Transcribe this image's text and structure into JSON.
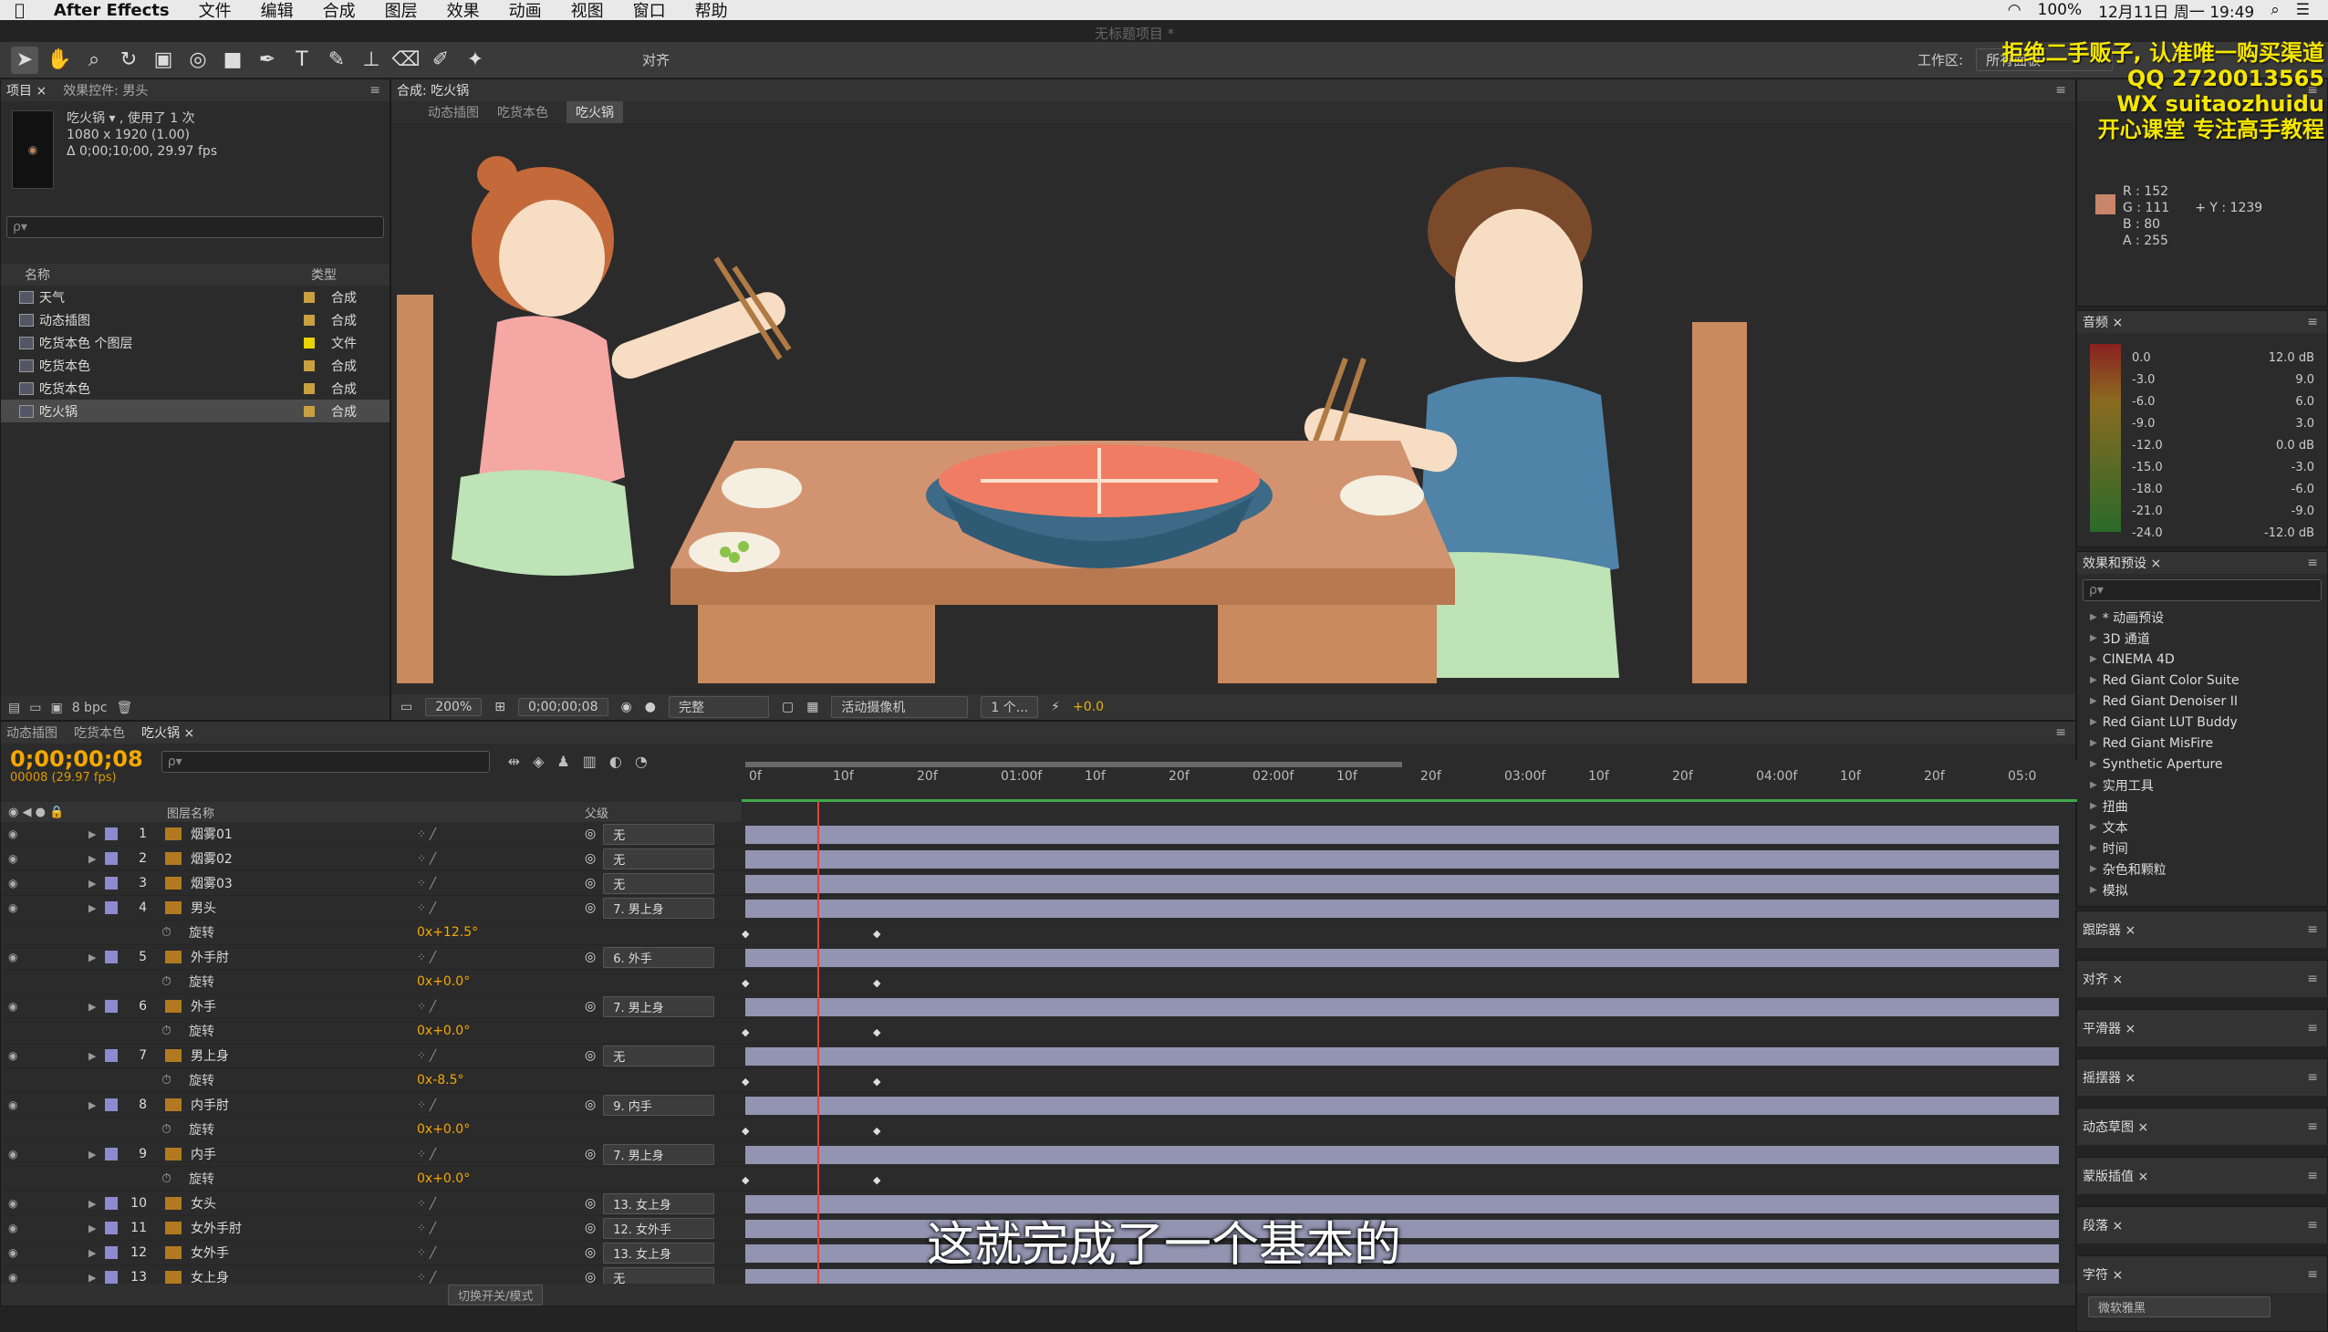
{
  "menubar": {
    "app": "After Effects",
    "items": [
      "文件",
      "编辑",
      "合成",
      "图层",
      "效果",
      "动画",
      "视图",
      "窗口",
      "帮助"
    ],
    "window_title": "无标题项目 *",
    "battery": "100%",
    "datetime": "12月11日 周一 19:49"
  },
  "toolbar": {
    "align_label": "对齐",
    "workspace_label": "工作区:",
    "workspace_value": "所有面板"
  },
  "project": {
    "tabs": [
      "项目 ×",
      "效果控件: 男头"
    ],
    "selected_name": "吃火锅 ▾ , 使用了 1 次",
    "size": "1080 x 1920 (1.00)",
    "duration": "Δ 0;00;10;00, 29.97 fps",
    "search_placeholder": "ρ▾",
    "col_name": "名称",
    "col_type": "类型",
    "items": [
      {
        "name": "天气",
        "type": "合成",
        "label": "#c8a040"
      },
      {
        "name": "动态插图",
        "type": "合成",
        "label": "#c8a040"
      },
      {
        "name": "吃货本色 个图层",
        "type": "文件",
        "label": "#e8d200"
      },
      {
        "name": "吃货本色",
        "type": "合成",
        "label": "#c8a040"
      },
      {
        "name": "吃货本色",
        "type": "合成",
        "label": "#c8a040"
      },
      {
        "name": "吃火锅",
        "type": "合成",
        "label": "#c8a040"
      }
    ],
    "footer_bpc": "8 bpc"
  },
  "viewer": {
    "tab": "合成: 吃火锅",
    "crumbs": [
      "动态插图",
      "吃货本色",
      "吃火锅"
    ],
    "zoom": "200%",
    "timecode": "0;00;00;08",
    "quality": "完整",
    "camera": "活动摄像机",
    "views": "1 个...",
    "offset": "+0.0"
  },
  "info": {
    "r": "R : 152",
    "g": "G : 111",
    "b": "B : 80",
    "a": "A : 255",
    "y": "+ Y : 1239",
    "swatch": "#c9856a"
  },
  "audio": {
    "tab": "音频 ×",
    "left_scale": [
      "0.0",
      "-3.0",
      "-6.0",
      "-9.0",
      "-12.0",
      "-15.0",
      "-18.0",
      "-21.0",
      "-24.0"
    ],
    "right_scale": [
      "12.0 dB",
      "9.0",
      "6.0",
      "3.0",
      "0.0 dB",
      "-3.0",
      "-6.0",
      "-9.0",
      "-12.0 dB"
    ]
  },
  "effects": {
    "tab": "效果和预设 ×",
    "items": [
      "* 动画预设",
      "3D 通道",
      "CINEMA 4D",
      "Red Giant Color Suite",
      "Red Giant Denoiser II",
      "Red Giant LUT Buddy",
      "Red Giant MisFire",
      "Synthetic Aperture",
      "实用工具",
      "扭曲",
      "文本",
      "时间",
      "杂色和颗粒",
      "模拟"
    ]
  },
  "stubs": [
    "跟踪器 ×",
    "对齐 ×",
    "平滑器 ×",
    "摇摆器 ×",
    "动态草图 ×",
    "蒙版插值 ×",
    "段落 ×",
    "字符 ×"
  ],
  "character": {
    "font": "微软雅黑"
  },
  "timeline": {
    "tabs": [
      "动态插图",
      "吃货本色",
      "吃火锅 ×"
    ],
    "timecode": "0;00;00;08",
    "frames": "00008 (29.97 fps)",
    "col_layer": "图层名称",
    "col_parent": "父级",
    "ruler": [
      "0f",
      "10f",
      "20f",
      "01:00f",
      "10f",
      "20f",
      "02:00f",
      "10f",
      "20f",
      "03:00f",
      "10f",
      "20f",
      "04:00f",
      "10f",
      "20f",
      "05:0"
    ],
    "rows": [
      {
        "kind": "layer",
        "num": "1",
        "name": "烟雾01",
        "parent": "无"
      },
      {
        "kind": "layer",
        "num": "2",
        "name": "烟雾02",
        "parent": "无"
      },
      {
        "kind": "layer",
        "num": "3",
        "name": "烟雾03",
        "parent": "无"
      },
      {
        "kind": "layer",
        "num": "4",
        "name": "男头",
        "parent": "7. 男上身"
      },
      {
        "kind": "prop",
        "name": "旋转",
        "value": "0x+12.5°"
      },
      {
        "kind": "layer",
        "num": "5",
        "name": "外手肘",
        "parent": "6. 外手"
      },
      {
        "kind": "prop",
        "name": "旋转",
        "value": "0x+0.0°"
      },
      {
        "kind": "layer",
        "num": "6",
        "name": "外手",
        "parent": "7. 男上身"
      },
      {
        "kind": "prop",
        "name": "旋转",
        "value": "0x+0.0°"
      },
      {
        "kind": "layer",
        "num": "7",
        "name": "男上身",
        "parent": "无"
      },
      {
        "kind": "prop",
        "name": "旋转",
        "value": "0x-8.5°"
      },
      {
        "kind": "layer",
        "num": "8",
        "name": "内手肘",
        "parent": "9. 内手"
      },
      {
        "kind": "prop",
        "name": "旋转",
        "value": "0x+0.0°"
      },
      {
        "kind": "layer",
        "num": "9",
        "name": "内手",
        "parent": "7. 男上身"
      },
      {
        "kind": "prop",
        "name": "旋转",
        "value": "0x+0.0°"
      },
      {
        "kind": "layer",
        "num": "10",
        "name": "女头",
        "parent": "13. 女上身"
      },
      {
        "kind": "layer",
        "num": "11",
        "name": "女外手肘",
        "parent": "12. 女外手"
      },
      {
        "kind": "layer",
        "num": "12",
        "name": "女外手",
        "parent": "13. 女上身"
      },
      {
        "kind": "layer",
        "num": "13",
        "name": "女上身",
        "parent": "无"
      }
    ],
    "footer": "切换开关/模式"
  },
  "subtitle": "这就完成了一个基本的",
  "watermark": {
    "line1": "拒绝二手贩子, 认准唯一购买渠道",
    "line2": "QQ 2720013565",
    "line3": "WX suitaozhuidu",
    "line4": "开心课堂 专注高手教程"
  },
  "colors": {
    "accent": "#f5a800",
    "layer_bar": "#a6a7c9",
    "playhead": "#e0453a"
  }
}
